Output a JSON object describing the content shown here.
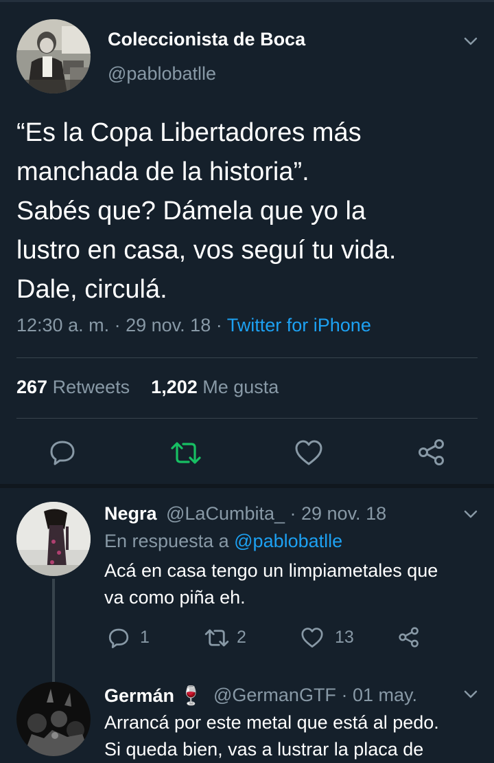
{
  "main_tweet": {
    "author_name": "Coleccionista de Boca",
    "author_handle": "@pablobatlle",
    "text_lines": [
      "“Es la Copa Libertadores más",
      "manchada de la historia”.",
      "Sabés que? Dámela que yo la",
      "lustro en casa, vos seguí tu vida.",
      "Dale, circulá."
    ],
    "time": "12:30 a. m.",
    "date": "29 nov. 18",
    "source": "Twitter for iPhone",
    "retweets_count": "267",
    "retweets_label": "Retweets",
    "likes_count": "1,202",
    "likes_label": "Me gusta"
  },
  "replies": [
    {
      "name": "Negra",
      "handle": "@LaCumbita_",
      "date": "29 nov. 18",
      "in_reply_prefix": "En respuesta a",
      "in_reply_mention": "@pablobatlle",
      "text_lines": [
        "Acá en casa tengo un limpiametales que",
        "va como piña eh."
      ],
      "reply_count": "1",
      "retweet_count": "2",
      "like_count": "13"
    },
    {
      "name": "Germán",
      "emoji": "🍷",
      "handle": "@GermanGTF",
      "date": "01 may.",
      "text_lines": [
        "Arrancá por este metal que está al pedo.",
        "Si queda bien, vas a lustrar la placa de"
      ]
    }
  ],
  "colors": {
    "background": "#15202b",
    "secondary_text": "#8899a6",
    "link": "#1da1f2",
    "retweet_active": "#17bf63",
    "divider": "#38444d"
  }
}
